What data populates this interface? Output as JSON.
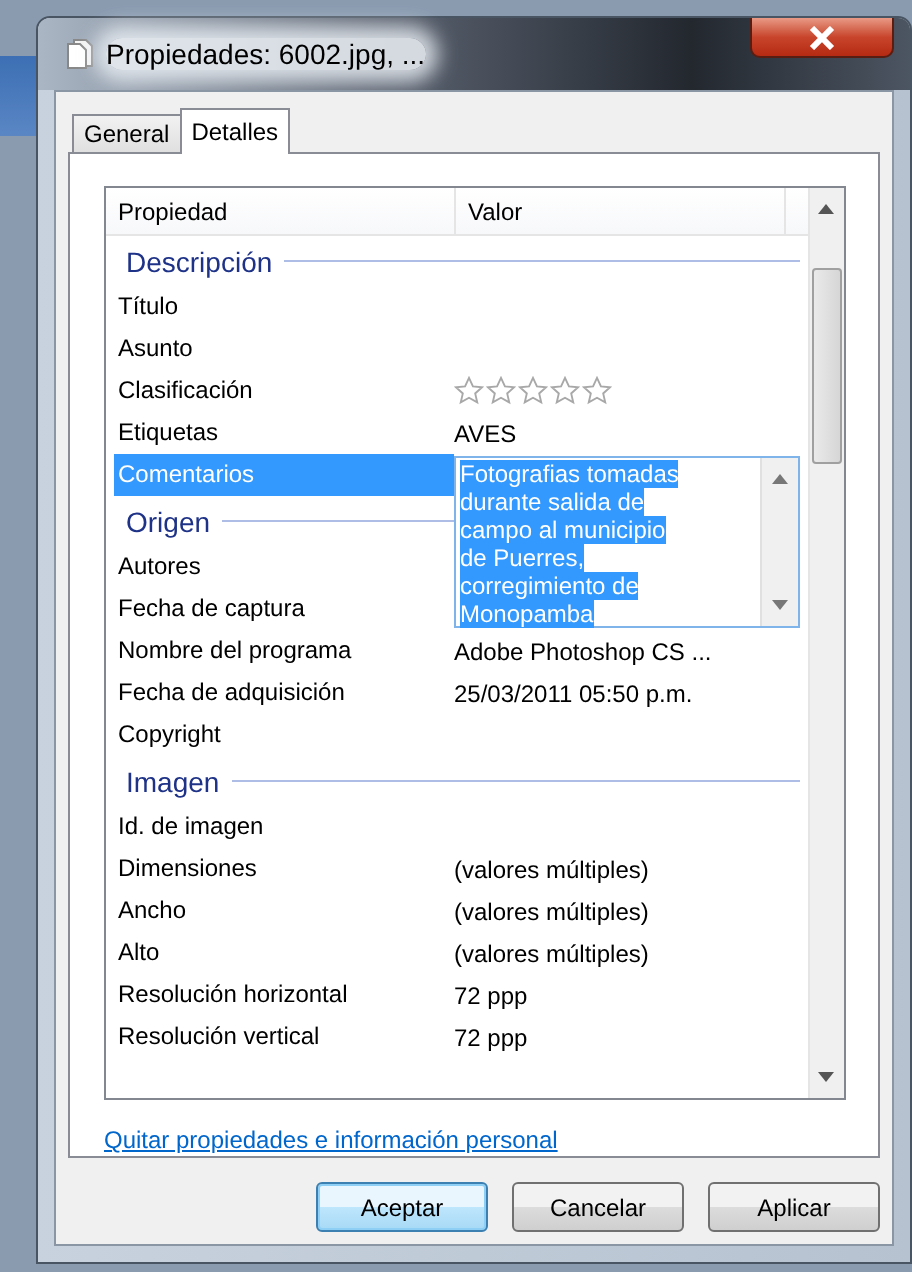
{
  "window": {
    "title": "Propiedades: 6002.jpg, ..."
  },
  "tabs": [
    {
      "label": "General",
      "selected": false
    },
    {
      "label": "Detalles",
      "selected": true
    }
  ],
  "list": {
    "columns": [
      "Propiedad",
      "Valor"
    ],
    "groups": [
      {
        "heading": "Descripción",
        "rows": [
          {
            "kind": "text",
            "name": "Título",
            "selected": false
          },
          {
            "kind": "text",
            "name": "Asunto",
            "selected": false
          },
          {
            "kind": "stars",
            "name": "Clasificación",
            "stars": 0,
            "selected": false
          },
          {
            "kind": "text",
            "name": "Etiquetas",
            "value": "AVES",
            "selected": false
          },
          {
            "kind": "comment",
            "name": "Comentarios",
            "value": "Fotografias tomadas durante salida de campo al municipio de Puerres, corregimiento de Monopamba",
            "selected": true
          }
        ]
      },
      {
        "heading": "Origen",
        "rows": [
          {
            "kind": "text",
            "name": "Autores",
            "selected": false
          },
          {
            "kind": "text",
            "name": "Fecha de captura",
            "selected": false
          },
          {
            "kind": "text",
            "name": "Nombre del programa",
            "value": "Adobe Photoshop CS ...",
            "selected": false
          },
          {
            "kind": "text",
            "name": "Fecha de adquisición",
            "value": "25/03/2011 05:50 p.m.",
            "selected": false
          },
          {
            "kind": "text",
            "name": "Copyright",
            "selected": false
          }
        ]
      },
      {
        "heading": "Imagen",
        "rows": [
          {
            "kind": "text",
            "name": "Id. de imagen",
            "selected": false
          },
          {
            "kind": "text",
            "name": "Dimensiones",
            "value": "(valores múltiples)",
            "selected": false
          },
          {
            "kind": "text",
            "name": "Ancho",
            "value": "(valores múltiples)",
            "selected": false
          },
          {
            "kind": "text",
            "name": "Alto",
            "value": "(valores múltiples)",
            "selected": false
          },
          {
            "kind": "text",
            "name": "Resolución horizontal",
            "value": "72 ppp",
            "selected": false
          },
          {
            "kind": "text",
            "name": "Resolución vertical",
            "value": "72 ppp",
            "selected": false
          }
        ]
      }
    ]
  },
  "link": "Quitar propiedades e información personal",
  "buttons": [
    {
      "label": "Aceptar",
      "default": true
    },
    {
      "label": "Cancelar",
      "default": false
    },
    {
      "label": "Aplicar",
      "default": false
    }
  ]
}
